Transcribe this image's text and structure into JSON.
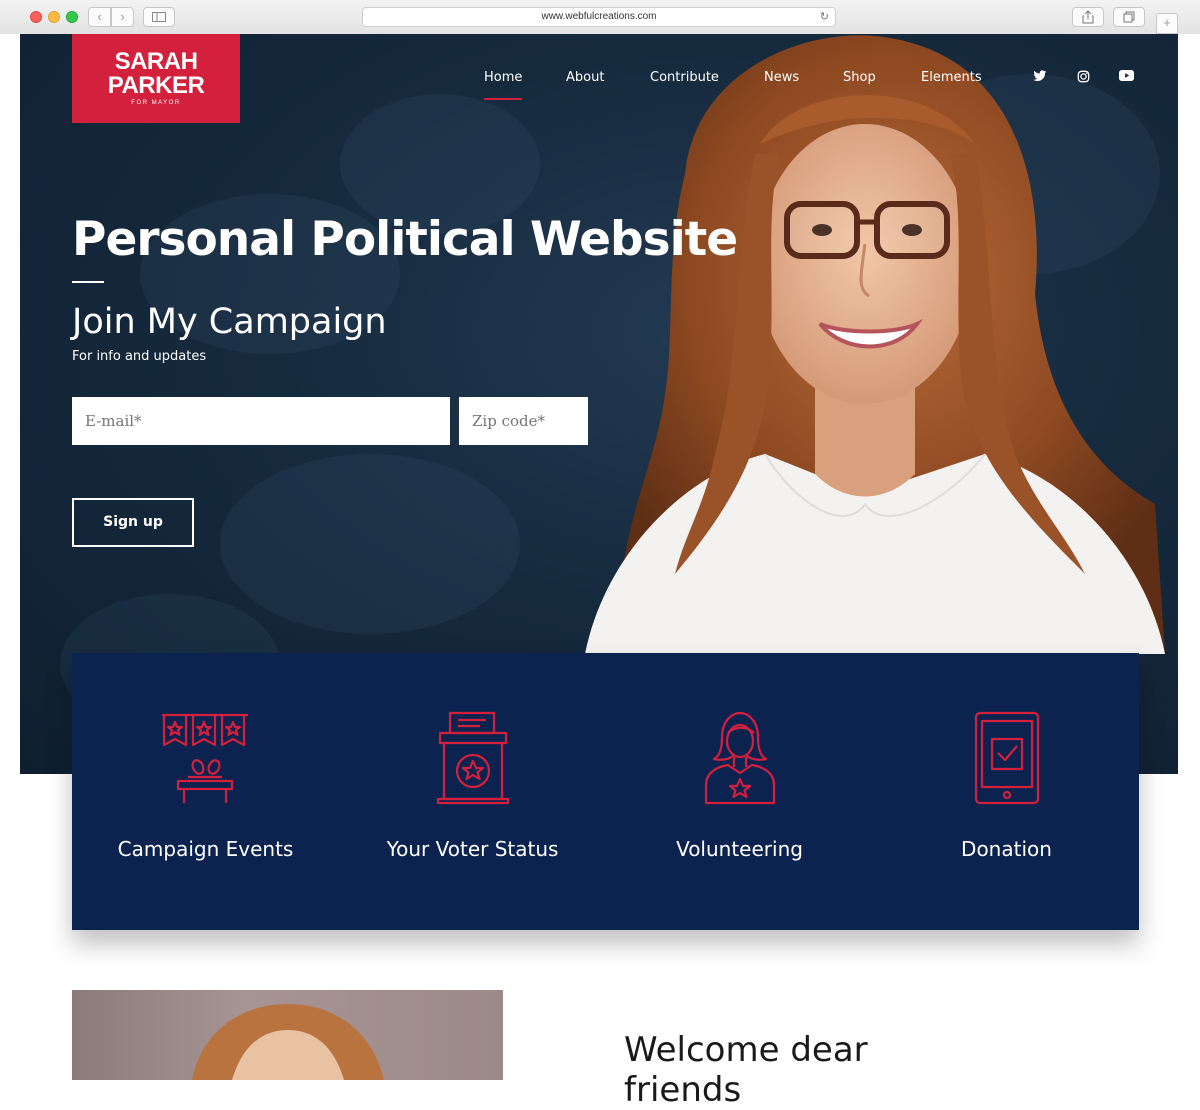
{
  "browser": {
    "url": "www.webfulcreations.com",
    "back_icon": "‹",
    "forward_icon": "›"
  },
  "logo": {
    "line1": "SARAH",
    "line2": "PARKER",
    "line3": "FOR MAYOR"
  },
  "nav": {
    "items": [
      "Home",
      "About",
      "Contribute",
      "News",
      "Shop",
      "Elements"
    ],
    "active": "Home"
  },
  "social": [
    "twitter-icon",
    "instagram-icon",
    "youtube-icon"
  ],
  "hero": {
    "title": "Personal Political Website",
    "subtitle": "Join My Campaign",
    "caption": "For info and updates",
    "email_placeholder": "E-mail*",
    "zip_placeholder": "Zip code*",
    "signup_label": "Sign up"
  },
  "features": [
    {
      "label": "Campaign Events",
      "icon": "campaign-events-icon"
    },
    {
      "label": "Your Voter Status",
      "icon": "ballot-box-icon"
    },
    {
      "label": "Volunteering",
      "icon": "volunteer-icon"
    },
    {
      "label": "Donation",
      "icon": "tablet-donation-icon"
    }
  ],
  "welcome": {
    "line1": "Welcome dear",
    "line2": "friends"
  },
  "colors": {
    "accent": "#d3203c",
    "panel": "#0c2350",
    "hero_bg": "#162a3e"
  }
}
